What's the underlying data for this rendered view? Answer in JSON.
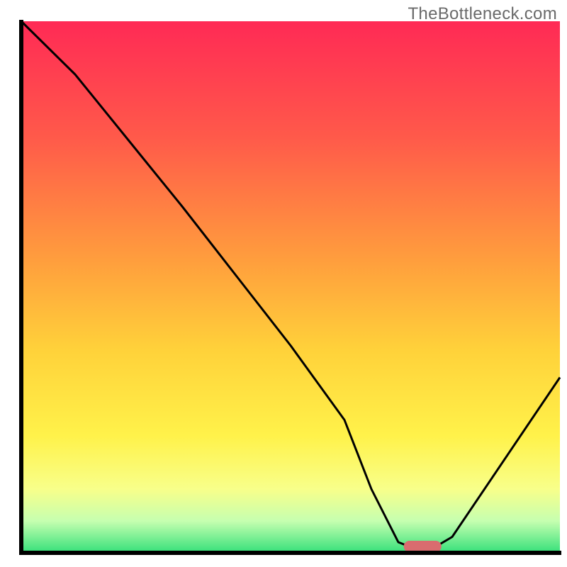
{
  "watermark": "TheBottleneck.com",
  "chart_data": {
    "type": "line",
    "title": "",
    "xlabel": "",
    "ylabel": "",
    "xlim": [
      0,
      100
    ],
    "ylim": [
      0,
      100
    ],
    "grid": false,
    "legend": false,
    "series": [
      {
        "name": "bottleneck-curve",
        "x": [
          0,
          10,
          22,
          30,
          40,
          50,
          60,
          65,
          70,
          75,
          80,
          100
        ],
        "y": [
          100,
          90,
          75,
          65,
          52,
          39,
          25,
          12,
          2,
          0,
          3,
          33
        ]
      }
    ],
    "marker": {
      "x_start": 71,
      "x_end": 78,
      "y": 1.2,
      "color": "#d96c6f"
    },
    "background_gradient": {
      "stops": [
        {
          "offset": 0.0,
          "color": "#ff2a55"
        },
        {
          "offset": 0.22,
          "color": "#ff5a4a"
        },
        {
          "offset": 0.45,
          "color": "#ff9e3d"
        },
        {
          "offset": 0.62,
          "color": "#ffd23a"
        },
        {
          "offset": 0.78,
          "color": "#fff24a"
        },
        {
          "offset": 0.88,
          "color": "#f8ff8a"
        },
        {
          "offset": 0.94,
          "color": "#c6ffb0"
        },
        {
          "offset": 1.0,
          "color": "#35e07a"
        }
      ]
    },
    "axis_color": "#000000",
    "axis_width": 6,
    "line_color": "#000000",
    "line_width": 3
  }
}
